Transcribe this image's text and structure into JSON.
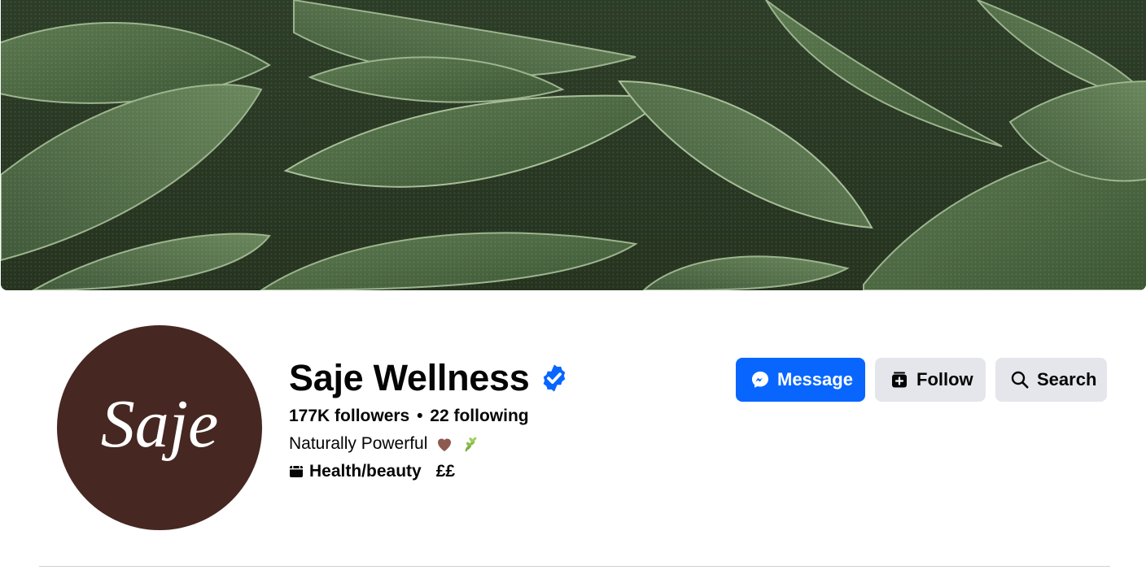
{
  "profile": {
    "name": "Saje Wellness",
    "verified": true,
    "stats": {
      "followers": "177K followers",
      "separator": "•",
      "following": "22 following"
    },
    "bio": "Naturally Powerful",
    "bio_emojis": [
      "brown-heart-icon",
      "herb-icon"
    ],
    "category": "Health/beauty",
    "price_range": "££",
    "avatar_logo_text": "Saje"
  },
  "actions": {
    "message_label": "Message",
    "follow_label": "Follow",
    "search_label": "Search"
  },
  "colors": {
    "primary_button": "#0866ff",
    "secondary_button": "#e4e6eb",
    "avatar_background": "#462722",
    "verified_badge": "#0866ff"
  },
  "cover": {
    "description_icon": "sage-leaves-cover-photo"
  }
}
